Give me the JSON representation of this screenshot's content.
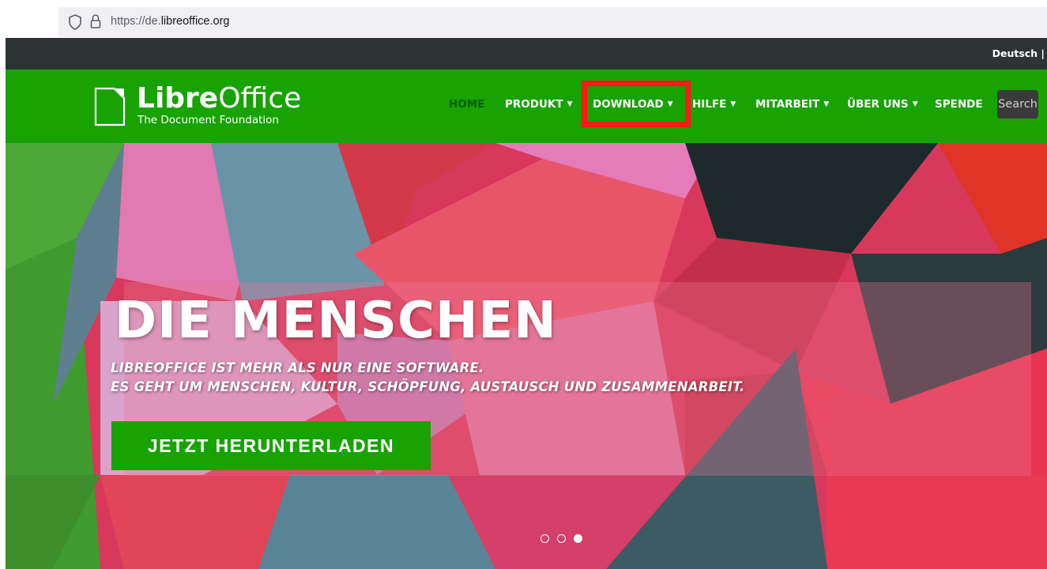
{
  "browser": {
    "url_prefix": "https://de.",
    "url_domain": "libreoffice.org"
  },
  "topbar": {
    "language": "Deutsch |"
  },
  "header": {
    "logo_name_bold": "Libre",
    "logo_name_regular": "Office",
    "logo_sub": "The Document Foundation"
  },
  "nav": {
    "items": [
      {
        "label": "HOME"
      },
      {
        "label": "PRODUKT"
      },
      {
        "label": "DOWNLOAD"
      },
      {
        "label": "HILFE"
      },
      {
        "label": "MITARBEIT"
      },
      {
        "label": "ÜBER UNS"
      },
      {
        "label": "SPENDE"
      }
    ],
    "search_label": "Search",
    "caret": "▼"
  },
  "hero": {
    "title": "DIE MENSCHEN",
    "subtitle_line1": "LIBREOFFICE IST MEHR ALS NUR EINE SOFTWARE.",
    "subtitle_line2": "ES GEHT UM MENSCHEN, KULTUR, SCHÖPFUNG, AUSTAUSCH UND ZUSAMMENARBEIT.",
    "cta_label": "JETZT HERUNTERLADEN",
    "carousel_count": 3,
    "carousel_active": 3
  },
  "colors": {
    "brand_green": "#18a303",
    "dark_strip": "#2e3436",
    "highlight_red": "#ff1a1a"
  }
}
